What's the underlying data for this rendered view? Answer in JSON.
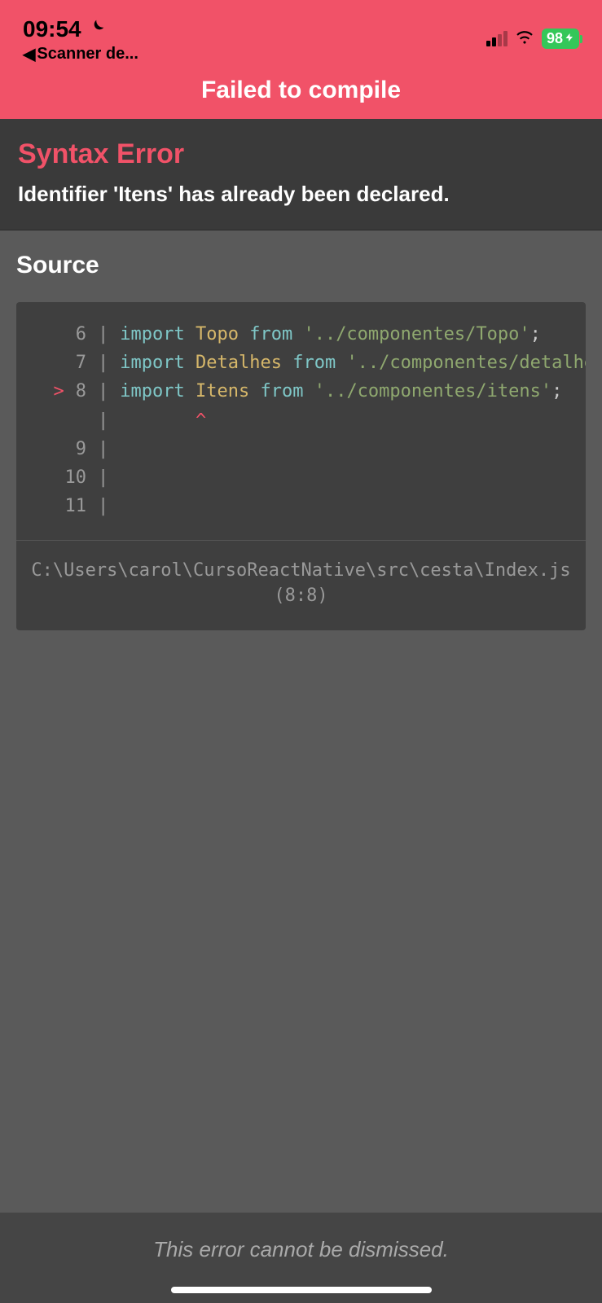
{
  "statusbar": {
    "time": "09:54",
    "back_app_label": "Scanner de...",
    "battery": "98"
  },
  "header": {
    "title": "Failed to compile"
  },
  "error": {
    "type": "Syntax Error",
    "message": "Identifier 'Itens' has already been declared."
  },
  "source": {
    "heading": "Source",
    "lines": [
      {
        "marker": "",
        "no": "6",
        "tokens": [
          {
            "t": "kw",
            "v": "import"
          },
          {
            "t": "sp",
            "v": " "
          },
          {
            "t": "id",
            "v": "Topo"
          },
          {
            "t": "sp",
            "v": " "
          },
          {
            "t": "kw",
            "v": "from"
          },
          {
            "t": "sp",
            "v": " "
          },
          {
            "t": "str",
            "v": "'../componentes/Topo'"
          },
          {
            "t": "punc",
            "v": ";"
          }
        ]
      },
      {
        "marker": "",
        "no": "7",
        "tokens": [
          {
            "t": "kw",
            "v": "import"
          },
          {
            "t": "sp",
            "v": " "
          },
          {
            "t": "id",
            "v": "Detalhes"
          },
          {
            "t": "sp",
            "v": " "
          },
          {
            "t": "kw",
            "v": "from"
          },
          {
            "t": "sp",
            "v": " "
          },
          {
            "t": "str",
            "v": "'../componentes/detalhes"
          }
        ]
      },
      {
        "marker": ">",
        "no": "8",
        "tokens": [
          {
            "t": "kw",
            "v": "import"
          },
          {
            "t": "sp",
            "v": " "
          },
          {
            "t": "id",
            "v": "Itens"
          },
          {
            "t": "sp",
            "v": " "
          },
          {
            "t": "kw",
            "v": "from"
          },
          {
            "t": "sp",
            "v": " "
          },
          {
            "t": "str",
            "v": "'../componentes/itens'"
          },
          {
            "t": "punc",
            "v": ";"
          }
        ]
      },
      {
        "marker": "",
        "no": "",
        "tokens": [
          {
            "t": "sp",
            "v": "       "
          },
          {
            "t": "caret",
            "v": "^"
          }
        ]
      },
      {
        "marker": "",
        "no": "9",
        "tokens": []
      },
      {
        "marker": "",
        "no": "10",
        "tokens": []
      },
      {
        "marker": "",
        "no": "11",
        "tokens": []
      }
    ],
    "file_path": "C:\\Users\\carol\\CursoReactNative\\src\\cesta\\Index.js",
    "file_loc": "(8:8)"
  },
  "footer": {
    "note": "This error cannot be dismissed."
  }
}
